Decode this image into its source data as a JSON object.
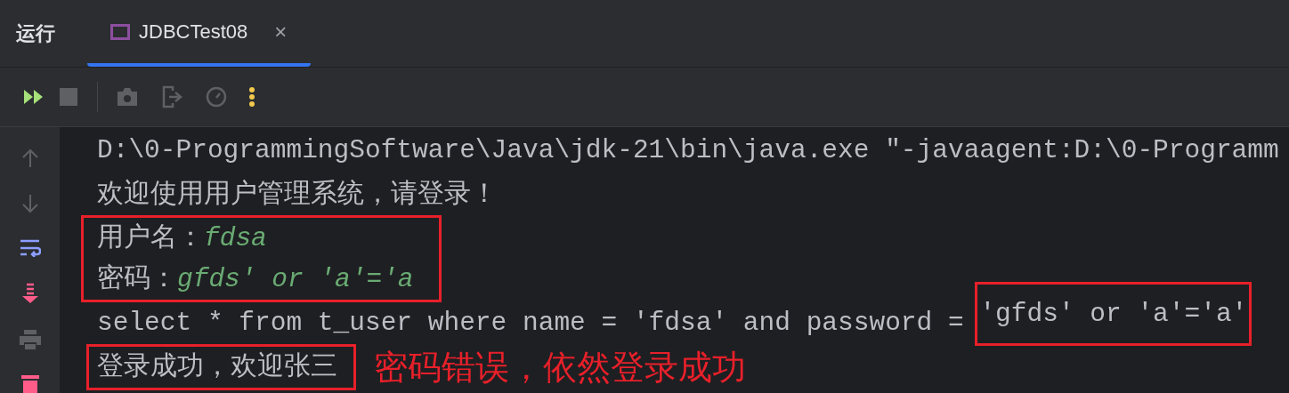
{
  "panel": {
    "title": "运行"
  },
  "tabs": [
    {
      "label": "JDBCTest08",
      "selected": true,
      "close": "×"
    }
  ],
  "console": {
    "lines": [
      {
        "kind": "plain",
        "text": "D:\\0-ProgrammingSoftware\\Java\\jdk-21\\bin\\java.exe \"-javaagent:D:\\0-Programm"
      },
      {
        "kind": "plain",
        "text": "欢迎使用用户管理系统，请登录！"
      },
      {
        "kind": "boxed_inputs",
        "lines": [
          {
            "label": "用户名：",
            "input": "fdsa"
          },
          {
            "label": "密码：",
            "input": "gfds' or 'a'='a"
          }
        ]
      },
      {
        "kind": "sql",
        "text": "select * from t_user where name = 'fdsa' and password = ",
        "boxed": "'gfds' or 'a'='a'"
      },
      {
        "kind": "result",
        "text": "登录成功，欢迎张三",
        "note": "密码错误，依然登录成功"
      }
    ]
  }
}
